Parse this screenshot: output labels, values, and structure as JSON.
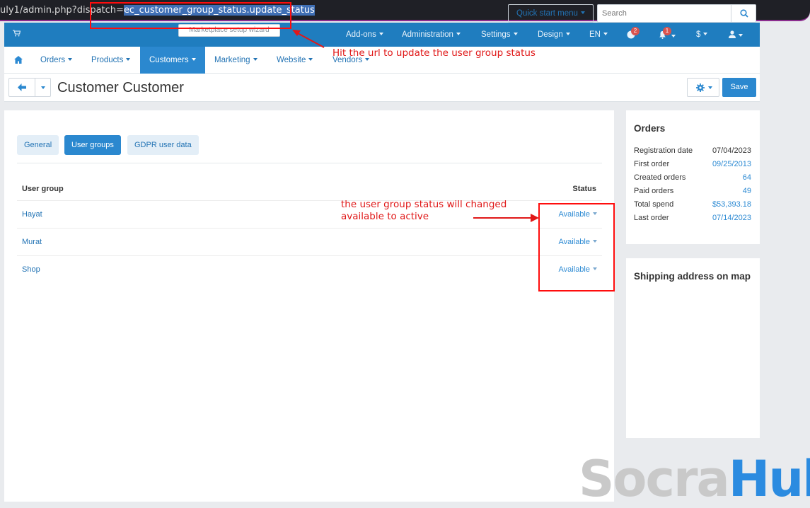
{
  "browser": {
    "url_prefix": "uly1/admin.php?dispatch=",
    "url_selected": "ec_customer_group_status.update_status"
  },
  "topnav": {
    "wizard_label": "Marketplace setup wizard",
    "items": [
      {
        "label": "Add-ons"
      },
      {
        "label": "Administration"
      },
      {
        "label": "Settings"
      },
      {
        "label": "Design"
      },
      {
        "label": "EN"
      },
      {
        "label": "$"
      }
    ],
    "notifications_badge": "2",
    "bell_badge": "1"
  },
  "subnav": {
    "tabs": [
      {
        "label": "Orders"
      },
      {
        "label": "Products"
      },
      {
        "label": "Customers"
      },
      {
        "label": "Marketing"
      },
      {
        "label": "Website"
      },
      {
        "label": "Vendors"
      }
    ],
    "quick_start": "Quick start menu",
    "search_placeholder": "Search"
  },
  "titlebar": {
    "title": "Customer Customer",
    "save_label": "Save"
  },
  "main": {
    "tabs": [
      {
        "label": "General"
      },
      {
        "label": "User groups"
      },
      {
        "label": "GDPR user data"
      }
    ],
    "table": {
      "col_group": "User group",
      "col_status": "Status",
      "rows": [
        {
          "name": "Hayat",
          "status": "Available"
        },
        {
          "name": "Murat",
          "status": "Available"
        },
        {
          "name": "Shop",
          "status": "Available"
        }
      ]
    }
  },
  "orders_panel": {
    "title": "Orders",
    "rows": [
      {
        "label": "Registration date",
        "value": "07/04/2023"
      },
      {
        "label": "First order",
        "value": "09/25/2013"
      },
      {
        "label": "Created orders",
        "value": "64"
      },
      {
        "label": "Paid orders",
        "value": "49"
      },
      {
        "label": "Total spend",
        "value": "$53,393.18"
      },
      {
        "label": "Last order",
        "value": "07/14/2023"
      }
    ]
  },
  "map_panel": {
    "title": "Shipping address on map"
  },
  "annotations": {
    "url_note": "Hit the url to update the user group status",
    "status_note_line1": "the user group status will changed",
    "status_note_line2": "available to active"
  },
  "watermark": {
    "part1": "Socra",
    "part2": "Hub"
  },
  "colors": {
    "primary": "#2b88cf",
    "nav": "#1f7dbf",
    "annotation": "#ff0d0d"
  }
}
